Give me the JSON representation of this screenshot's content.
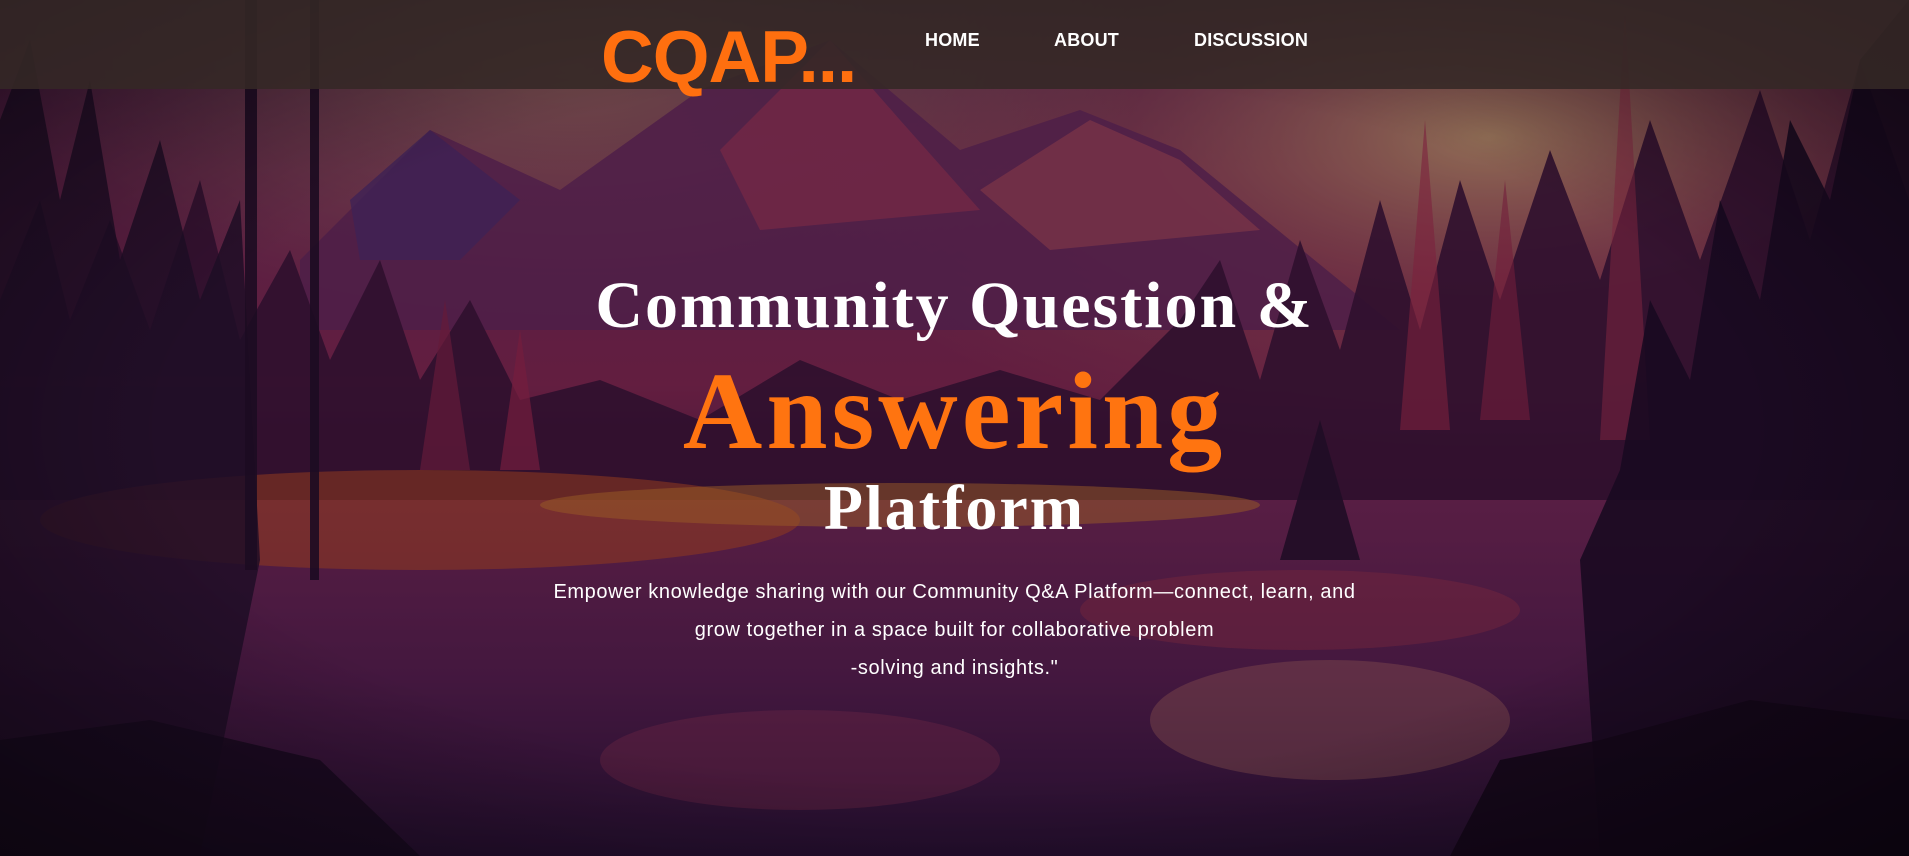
{
  "brand": {
    "name": "CQAP..."
  },
  "nav": {
    "items": [
      {
        "label": "HOME"
      },
      {
        "label": "ABOUT"
      },
      {
        "label": "DISCUSSION"
      }
    ]
  },
  "hero": {
    "title_line1": "Community Question &",
    "title_highlight": "Answering",
    "title_line3": "Platform",
    "tagline_lines": [
      "Empower knowledge sharing with our Community Q&A Platform—connect, learn, and",
      "grow together in a space built for collaborative problem",
      "-solving and insights.\""
    ]
  },
  "colors": {
    "accent": "#ff7410",
    "text": "#ffffff",
    "navbar_bg": "#342826"
  }
}
